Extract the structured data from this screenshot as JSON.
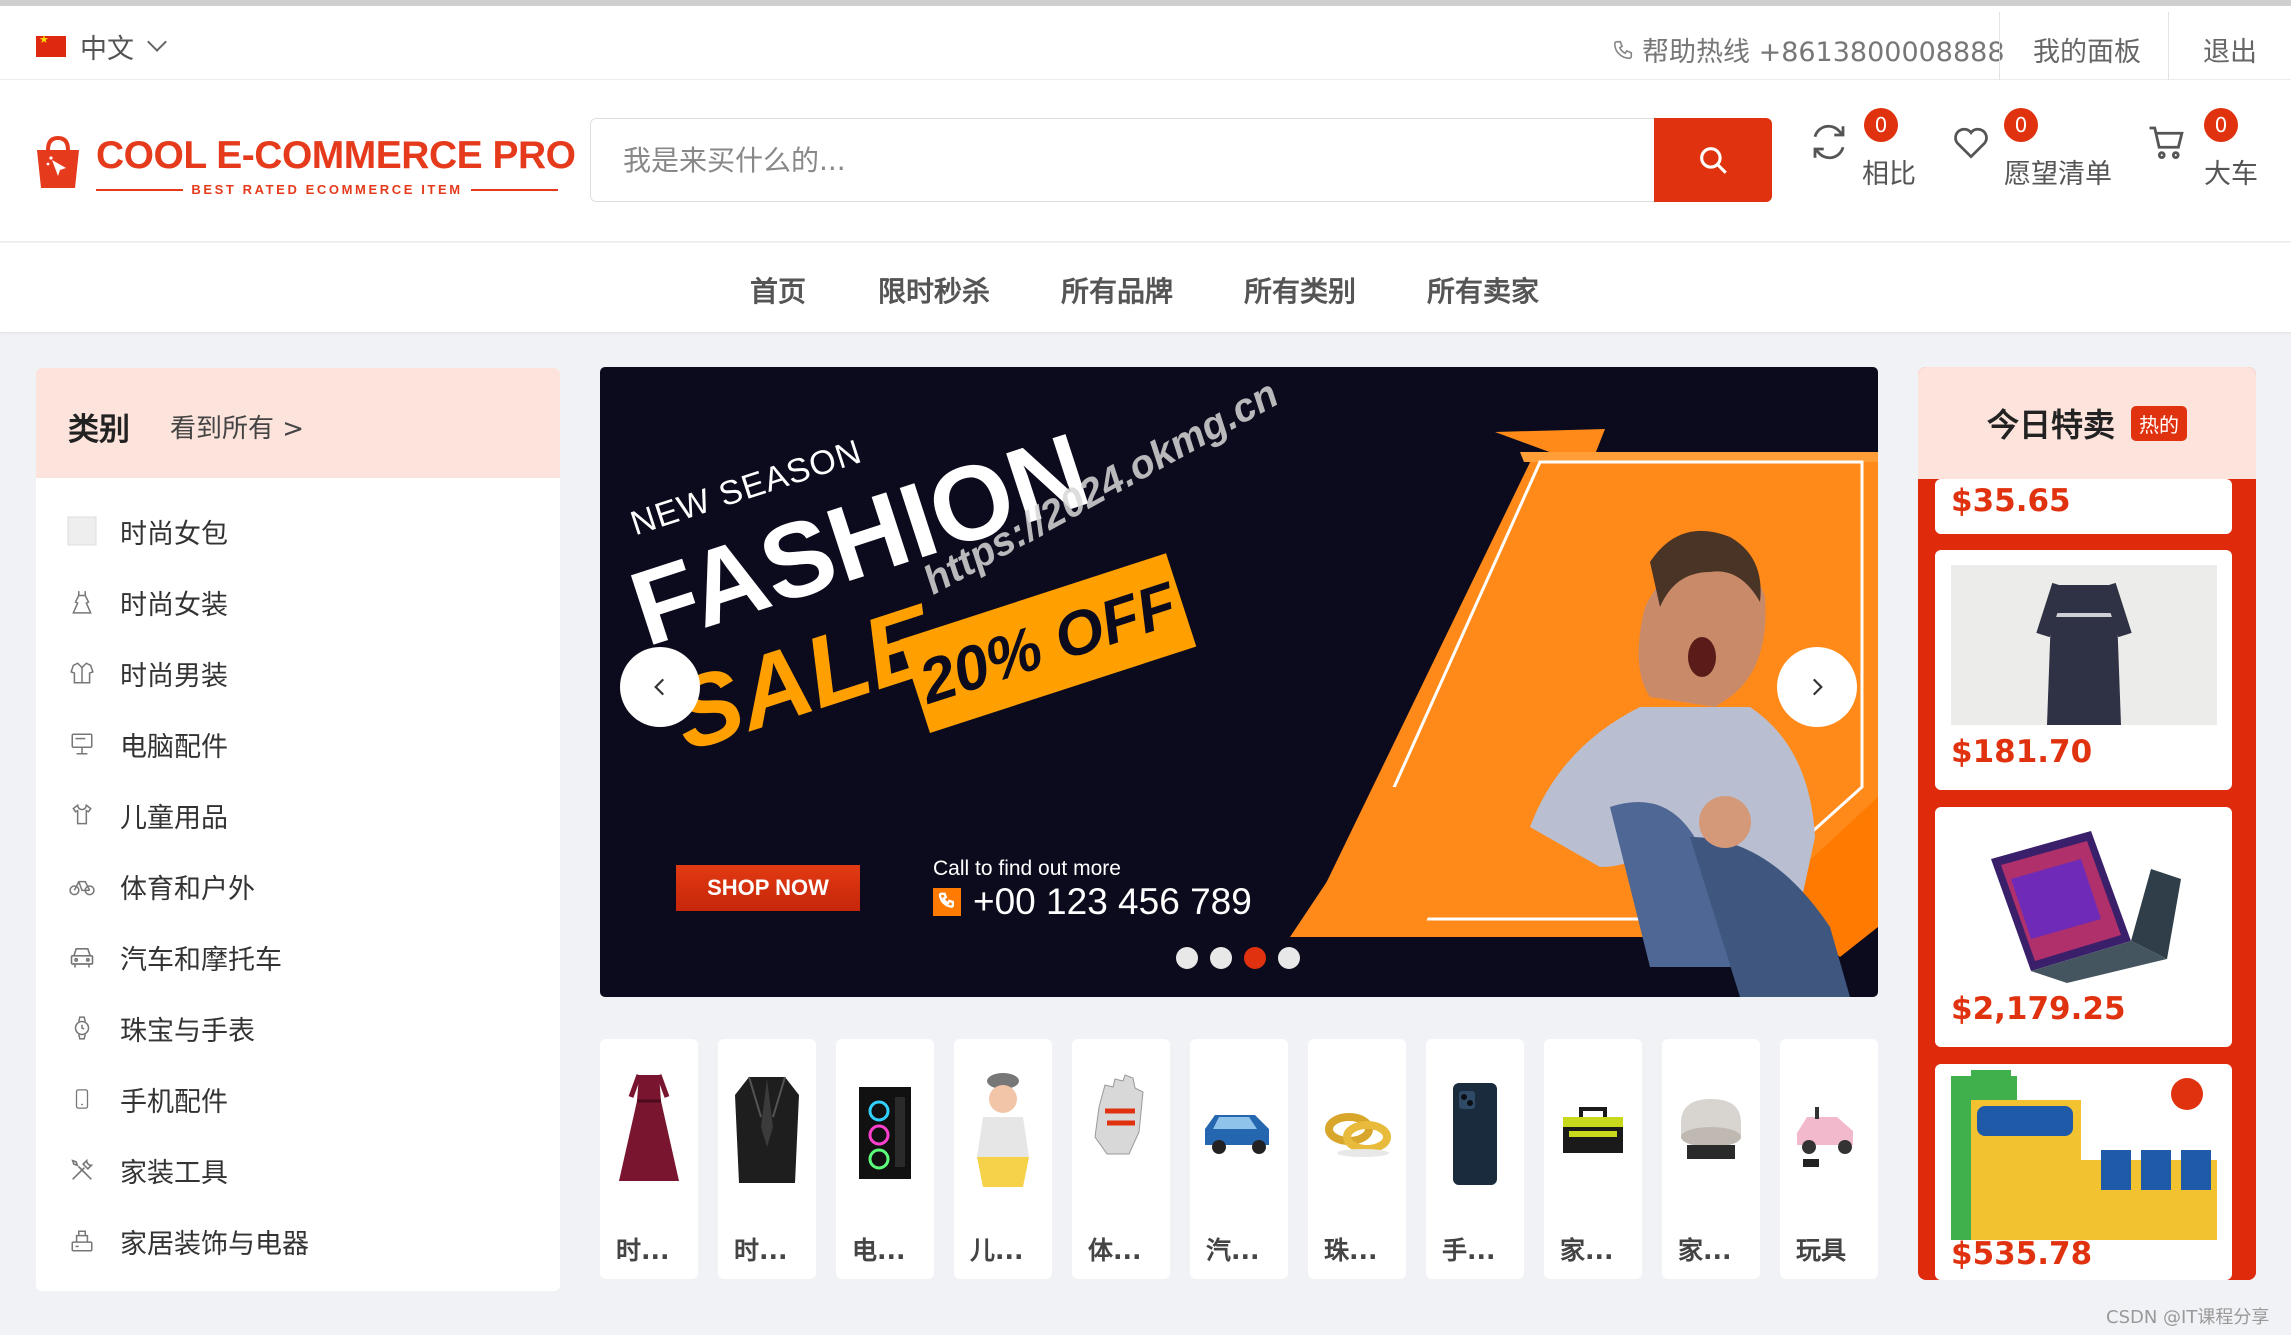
{
  "topbar": {
    "language": "中文",
    "hotline": "帮助热线 +8613800008888",
    "dashboard": "我的面板",
    "logout": "退出"
  },
  "logo": {
    "name": "COOL E-COMMERCE PRO",
    "tagline": "BEST RATED ECOMMERCE ITEM"
  },
  "search": {
    "placeholder": "我是来买什么的..."
  },
  "header_actions": {
    "compare": {
      "label": "相比",
      "count": "0"
    },
    "wishlist": {
      "label": "愿望清单",
      "count": "0"
    },
    "cart": {
      "label": "大车",
      "count": "0"
    }
  },
  "nav": [
    "首页",
    "限时秒杀",
    "所有品牌",
    "所有类别",
    "所有卖家"
  ],
  "categories": {
    "title": "类别",
    "view_all": "看到所有 >",
    "items": [
      "时尚女包",
      "时尚女装",
      "时尚男装",
      "电脑配件",
      "儿童用品",
      "体育和户外",
      "汽车和摩托车",
      "珠宝与手表",
      "手机配件",
      "家装工具",
      "家居装饰与电器"
    ]
  },
  "banner": {
    "kicker": "NEW SEASON",
    "headline": "FASHION",
    "headline2": "SALE",
    "discount": "20% OFF",
    "watermark": "https://2024.okmg.cn",
    "cta": "SHOP NOW",
    "call_text": "Call to find out more",
    "phone": "+00 123 456 789",
    "active_slide": 3,
    "slide_count": 4
  },
  "thumbnails": [
    "时...",
    "时...",
    "电...",
    "儿...",
    "体...",
    "汽...",
    "珠...",
    "手...",
    "家...",
    "家...",
    "玩具"
  ],
  "deals": {
    "title": "今日特卖",
    "badge": "热的",
    "items": [
      {
        "price": "$35.65"
      },
      {
        "price": "$181.70"
      },
      {
        "price": "$2,179.25"
      },
      {
        "price": "$535.78"
      }
    ]
  },
  "footer_mark": "CSDN @IT课程分享",
  "colors": {
    "accent": "#e0320e",
    "soft": "#fce3db",
    "banner_bg": "#0c0b1d",
    "orange": "#ff8a1a"
  }
}
